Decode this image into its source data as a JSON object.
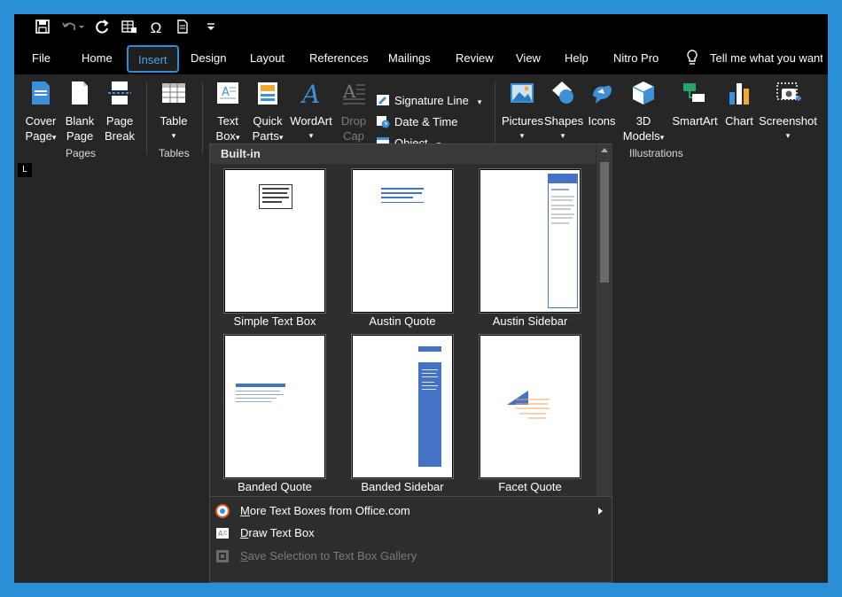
{
  "quick_access": {
    "icons": [
      "save-icon",
      "undo-icon",
      "redo-icon",
      "table-icon",
      "symbol-icon",
      "document-icon",
      "customize-icon"
    ],
    "symbol_glyph": "Ω"
  },
  "tabs": [
    "File",
    "Home",
    "Insert",
    "Design",
    "Layout",
    "References",
    "Mailings",
    "Review",
    "View",
    "Help",
    "Nitro Pro"
  ],
  "active_tab": "Insert",
  "tell_me": "Tell me what you want t",
  "ribbon": {
    "pages": {
      "group_label": "Pages",
      "cover_page": [
        "Cover",
        "Page"
      ],
      "blank_page": [
        "Blank",
        "Page"
      ],
      "page_break": [
        "Page",
        "Break"
      ]
    },
    "tables": {
      "group_label": "Tables",
      "table": "Table"
    },
    "text": {
      "text_box": [
        "Text",
        "Box"
      ],
      "quick_parts": [
        "Quick",
        "Parts"
      ],
      "wordart": "WordArt",
      "drop_cap": [
        "Drop",
        "Cap"
      ],
      "signature_line": "Signature Line",
      "date_time": "Date & Time",
      "object": "Object"
    },
    "illustrations": {
      "group_label": "Illustrations",
      "pictures": "Pictures",
      "shapes": "Shapes",
      "icons": "Icons",
      "models": [
        "3D",
        "Models"
      ],
      "smartart": "SmartArt",
      "chart": "Chart",
      "screenshot": "Screenshot"
    }
  },
  "ruler_corner": "L",
  "gallery": {
    "header": "Built-in",
    "items": [
      {
        "name": "Simple Text Box"
      },
      {
        "name": "Austin Quote"
      },
      {
        "name": "Austin Sidebar"
      },
      {
        "name": "Banded Quote"
      },
      {
        "name": "Banded Sidebar"
      },
      {
        "name": "Facet Quote"
      }
    ],
    "menu": [
      {
        "label": "More Text Boxes from Office.com",
        "enabled": true,
        "submenu": true
      },
      {
        "label": "Draw Text Box",
        "enabled": true,
        "submenu": false
      },
      {
        "label": "Save Selection to Text Box Gallery",
        "enabled": false,
        "submenu": false
      }
    ]
  },
  "colors": {
    "frame": "#2b8fd6",
    "accent_blue": "#4472c4",
    "facet_orange": "#f4a460"
  }
}
